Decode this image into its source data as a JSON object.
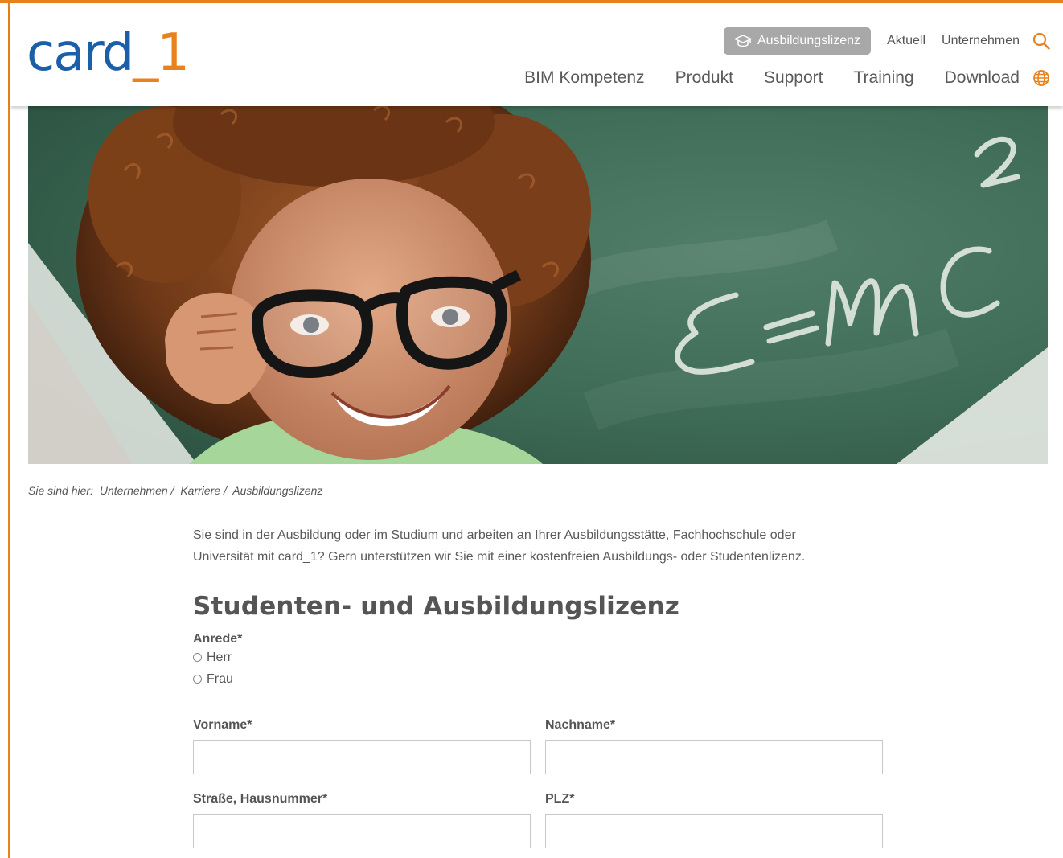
{
  "brand": {
    "logo_main": "card",
    "logo_underscore": "_",
    "logo_one": "1"
  },
  "topnav": {
    "pill_label": "Ausbildungslizenz",
    "pill_icon": "graduation-cap-icon",
    "links": [
      "Aktuell",
      "Unternehmen"
    ],
    "search_icon": "search-icon"
  },
  "mainnav": {
    "items": [
      "BIM Kompetenz",
      "Produkt",
      "Support",
      "Training",
      "Download"
    ],
    "globe_icon": "globe-icon"
  },
  "hero": {
    "chalk_text": "E=mc²"
  },
  "breadcrumb": {
    "prefix": "Sie sind hier:",
    "items": [
      "Unternehmen",
      "Karriere",
      "Ausbildungslizenz"
    ],
    "separator": "/"
  },
  "content": {
    "intro_line1": "Sie sind in der Ausbildung oder im Studium und arbeiten an Ihrer Ausbildungsstätte, Fachhochschule oder",
    "intro_line2": "Universität mit card_1? Gern unterstützen wir Sie mit einer kostenfreien Ausbildungs- oder Studentenlizenz.",
    "title": "Studenten- und Ausbildungslizenz"
  },
  "form": {
    "anrede_label": "Anrede*",
    "anrede_options": [
      "Herr",
      "Frau"
    ],
    "vorname_label": "Vorname*",
    "vorname_value": "",
    "nachname_label": "Nachname*",
    "nachname_value": "",
    "strasse_label": "Straße, Hausnummer*",
    "strasse_value": "",
    "plz_label": "PLZ*",
    "plz_value": ""
  },
  "colors": {
    "brand_blue": "#1a5fa8",
    "accent_orange": "#e8821e",
    "pill_gray": "#a8a8a8"
  }
}
